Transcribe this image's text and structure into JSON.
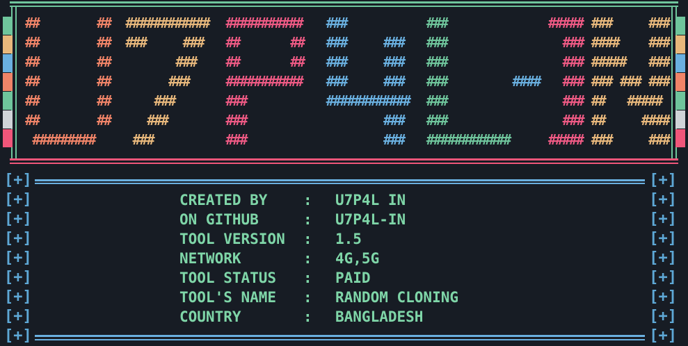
{
  "logo": {
    "glyph": "#",
    "colors": {
      "orange": "#f08468",
      "tan": "#e8b87c",
      "pink": "#ee5a84",
      "blue": "#6ab0e0",
      "green": "#6fc59c",
      "frame_top": "#6fc59c",
      "frame_bottom": "#f0567a"
    },
    "stripe_colors": [
      "#6fc59c",
      "#e8b87c",
      "#6ab0e0",
      "#f08468",
      "#6fc59c",
      "#d0d4d8",
      "#f0567a"
    ]
  },
  "info": {
    "bracket": "[+]",
    "rows": [
      {
        "key": "CREATED BY",
        "sep": ":",
        "value": "U7P4L IN"
      },
      {
        "key": "ON GITHUB",
        "sep": ":",
        "value": "U7P4L-IN"
      },
      {
        "key": "TOOL VERSION",
        "sep": ":",
        "value": "1.5"
      },
      {
        "key": "NETWORK",
        "sep": ":",
        "value": "4G,5G"
      },
      {
        "key": "TOOL STATUS",
        "sep": ":",
        "value": "PAID"
      },
      {
        "key": "TOOL'S NAME",
        "sep": ":",
        "value": "RANDOM CLONING"
      },
      {
        "key": "COUNTRY",
        "sep": ":",
        "value": "BANGLADESH"
      }
    ]
  }
}
